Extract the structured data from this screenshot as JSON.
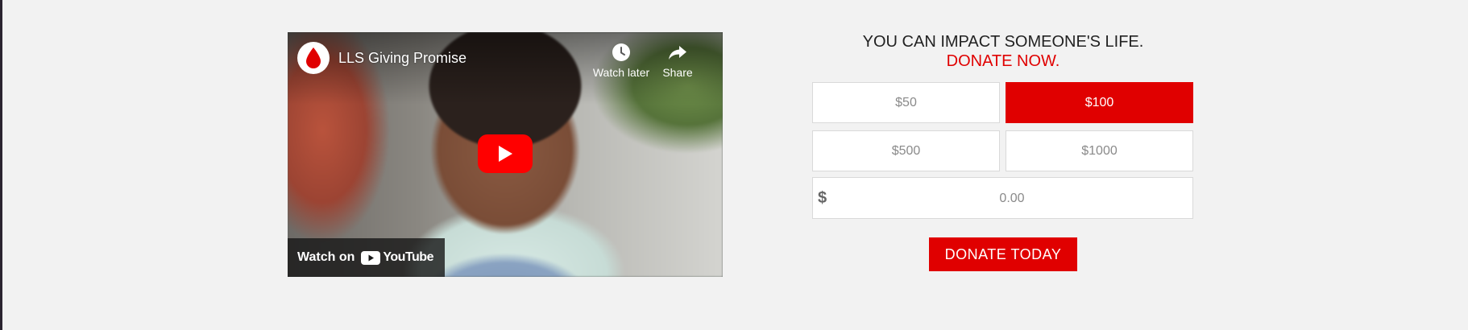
{
  "video": {
    "title": "LLS Giving Promise",
    "watch_later_label": "Watch later",
    "share_label": "Share",
    "watch_on_label": "Watch on",
    "platform_name": "YouTube",
    "accent_color": "#ff0000"
  },
  "donate": {
    "headline": "YOU CAN IMPACT SOMEONE'S LIFE.",
    "cta": "DONATE NOW.",
    "amounts": [
      {
        "label": "$50",
        "selected": false
      },
      {
        "label": "$100",
        "selected": true
      },
      {
        "label": "$500",
        "selected": false
      },
      {
        "label": "$1000",
        "selected": false
      }
    ],
    "custom_currency": "$",
    "custom_placeholder": "0.00",
    "custom_value": "",
    "button_label": "DONATE TODAY",
    "accent_color": "#e00000"
  },
  "icons": [
    "blood-drop-icon",
    "clock-icon",
    "share-arrow-icon",
    "play-icon",
    "youtube-logo-icon"
  ]
}
